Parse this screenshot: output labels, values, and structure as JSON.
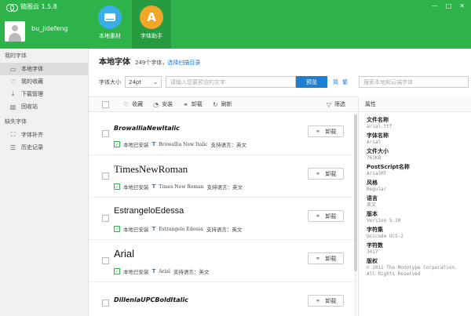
{
  "app": {
    "title": "链图云 1.5.8"
  },
  "user": {
    "name": "bu_jidefeng"
  },
  "nav": [
    {
      "label": "本地素材"
    },
    {
      "label": "字体助手",
      "glyph": "A"
    }
  ],
  "window": {
    "minimize": "—",
    "maximize": "□",
    "close": "✕"
  },
  "sidebar": {
    "section1": "我的字体",
    "items1": [
      {
        "label": "本地字体"
      },
      {
        "label": "我的收藏"
      },
      {
        "label": "下载管理"
      },
      {
        "label": "回收站"
      }
    ],
    "section2": "缺失字体",
    "items2": [
      {
        "label": "字体补齐"
      },
      {
        "label": "历史记录"
      }
    ]
  },
  "main": {
    "title": "本地字体",
    "count": "249个字体，",
    "scan_link": "选择扫描目录",
    "size_label": "字体大小",
    "size_value": "24pt",
    "preview_placeholder": "请输入您要预览的文字",
    "preview_button": "预览",
    "link_a": "简",
    "link_b": "繁",
    "search_placeholder": "搜索本地和云端字体"
  },
  "toolbar": {
    "favorite": "收藏",
    "install": "安装",
    "uninstall": "卸载",
    "refresh": "刷新",
    "filter": "筛选"
  },
  "fonts": [
    {
      "name": "BrowalliaNewItalic",
      "status": "本地已安装",
      "family": "Browallia New Italic",
      "lang_label": "支持语言：",
      "lang": "英文",
      "action": "卸载"
    },
    {
      "name": "TimesNewRoman",
      "status": "本地已安装",
      "family": "Times New Roman",
      "lang_label": "支持语言：",
      "lang": "英文",
      "action": "卸载"
    },
    {
      "name": "EstrangeloEdessa",
      "status": "本地已安装",
      "family": "Estrangelo Edessa",
      "lang_label": "支持语言：",
      "lang": "英文",
      "action": "卸载"
    },
    {
      "name": "Arial",
      "status": "本地已安装",
      "family": "Arial",
      "lang_label": "支持语言：",
      "lang": "英文",
      "action": "卸载"
    },
    {
      "name": "DilleniaUPCBoldItalic",
      "status": "",
      "family": "",
      "lang_label": "",
      "lang": "",
      "action": "卸载"
    }
  ],
  "properties": {
    "header": "属性",
    "items": [
      {
        "label": "文件名称",
        "value": "arial.ttf"
      },
      {
        "label": "字体名称",
        "value": "Arial"
      },
      {
        "label": "文件大小",
        "value": "761KB"
      },
      {
        "label": "PostScript名称",
        "value": "ArialMT"
      },
      {
        "label": "风格",
        "value": "Regular"
      },
      {
        "label": "语言",
        "value": "英文"
      },
      {
        "label": "版本",
        "value": "Version 5.10"
      },
      {
        "label": "字符集",
        "value": "Unicode UCS-2"
      },
      {
        "label": "字符数",
        "value": "3417"
      },
      {
        "label": "版权",
        "value": "© 2011 The Monotype Corporation. All Rights Reserved"
      }
    ]
  },
  "colors": {
    "brand": "#2eb24a",
    "accent": "#1e7fd1",
    "nav_blue": "#3aaee9",
    "nav_orange": "#f4a627"
  }
}
